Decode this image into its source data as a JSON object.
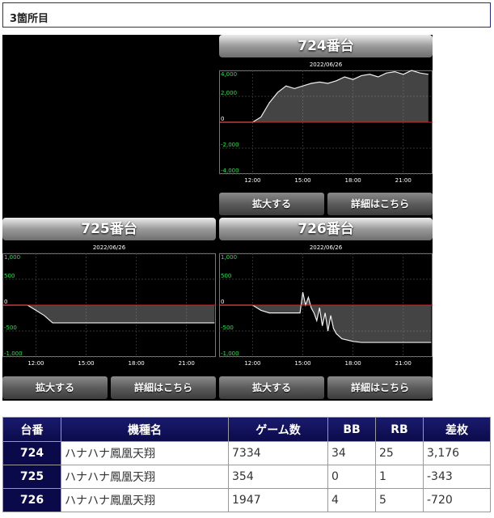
{
  "section": {
    "title": "3箇所目"
  },
  "buttons": {
    "zoom": "拡大する",
    "detail": "詳細はこちら"
  },
  "units": [
    {
      "id": "724",
      "title": "724番台",
      "date": "2022/06/26",
      "y_ticks": [
        "4,000",
        "2,000",
        "0",
        "-2,000",
        "-4,000"
      ],
      "x_ticks": [
        "12:00",
        "15:00",
        "18:00",
        "21:00"
      ]
    },
    {
      "id": "725",
      "title": "725番台",
      "date": "2022/06/26",
      "y_ticks": [
        "1,000",
        "500",
        "0",
        "-500",
        "-1,000"
      ],
      "x_ticks": [
        "12:00",
        "15:00",
        "18:00",
        "21:00"
      ]
    },
    {
      "id": "726",
      "title": "726番台",
      "date": "2022/06/26",
      "y_ticks": [
        "1,000",
        "500",
        "0",
        "-500",
        "-1,000"
      ],
      "x_ticks": [
        "12:00",
        "15:00",
        "18:00",
        "21:00"
      ]
    }
  ],
  "chart_data": [
    {
      "type": "area",
      "title": "724番台",
      "subtitle": "2022/06/26",
      "x": [
        "10:00",
        "11:00",
        "12:00",
        "12:30",
        "13:00",
        "13:30",
        "14:00",
        "14:30",
        "15:00",
        "15:30",
        "16:00",
        "16:30",
        "17:00",
        "17:30",
        "18:00",
        "18:30",
        "19:00",
        "19:30",
        "20:00",
        "20:30",
        "21:00",
        "21:30",
        "22:00",
        "22:30"
      ],
      "series": [
        {
          "values": [
            0,
            0,
            0,
            400,
            1500,
            2300,
            2800,
            2600,
            2800,
            3000,
            3100,
            3000,
            3200,
            3500,
            3300,
            3600,
            3700,
            3500,
            3800,
            3900,
            3700,
            4000,
            3800,
            3700
          ]
        }
      ],
      "ylim": [
        -4000,
        4000
      ]
    },
    {
      "type": "area",
      "title": "725番台",
      "subtitle": "2022/06/26",
      "x": [
        "10:00",
        "11:00",
        "11:30",
        "12:00",
        "12:30",
        "13:00",
        "15:00",
        "18:00",
        "21:00",
        "22:40"
      ],
      "series": [
        {
          "values": [
            0,
            0,
            0,
            -100,
            -200,
            -343,
            -343,
            -343,
            -343,
            -343
          ]
        }
      ],
      "ylim": [
        -1000,
        1000
      ]
    },
    {
      "type": "area",
      "title": "726番台",
      "subtitle": "2022/06/26",
      "x": [
        "10:00",
        "12:00",
        "12:30",
        "13:00",
        "14:00",
        "14:50",
        "15:00",
        "15:10",
        "15:20",
        "15:30",
        "15:40",
        "15:50",
        "16:00",
        "16:10",
        "16:20",
        "16:30",
        "16:40",
        "16:50",
        "17:00",
        "17:20",
        "18:00",
        "18:30",
        "19:00",
        "20:00",
        "21:00",
        "22:40"
      ],
      "series": [
        {
          "values": [
            0,
            0,
            -100,
            -150,
            -150,
            -150,
            250,
            0,
            150,
            -50,
            -150,
            -300,
            -50,
            -400,
            -150,
            -500,
            -200,
            -450,
            -550,
            -650,
            -700,
            -720,
            -720,
            -720,
            -720,
            -720
          ]
        }
      ],
      "ylim": [
        -1000,
        1000
      ]
    }
  ],
  "table": {
    "headers": [
      "台番",
      "機種名",
      "ゲーム数",
      "BB",
      "RB",
      "差枚"
    ],
    "rows": [
      {
        "num": "724",
        "name": "ハナハナ鳳凰天翔",
        "games": "7334",
        "bb": "34",
        "rb": "25",
        "diff": "3,176"
      },
      {
        "num": "725",
        "name": "ハナハナ鳳凰天翔",
        "games": "354",
        "bb": "0",
        "rb": "1",
        "diff": "-343"
      },
      {
        "num": "726",
        "name": "ハナハナ鳳凰天翔",
        "games": "1947",
        "bb": "4",
        "rb": "5",
        "diff": "-720"
      }
    ]
  }
}
